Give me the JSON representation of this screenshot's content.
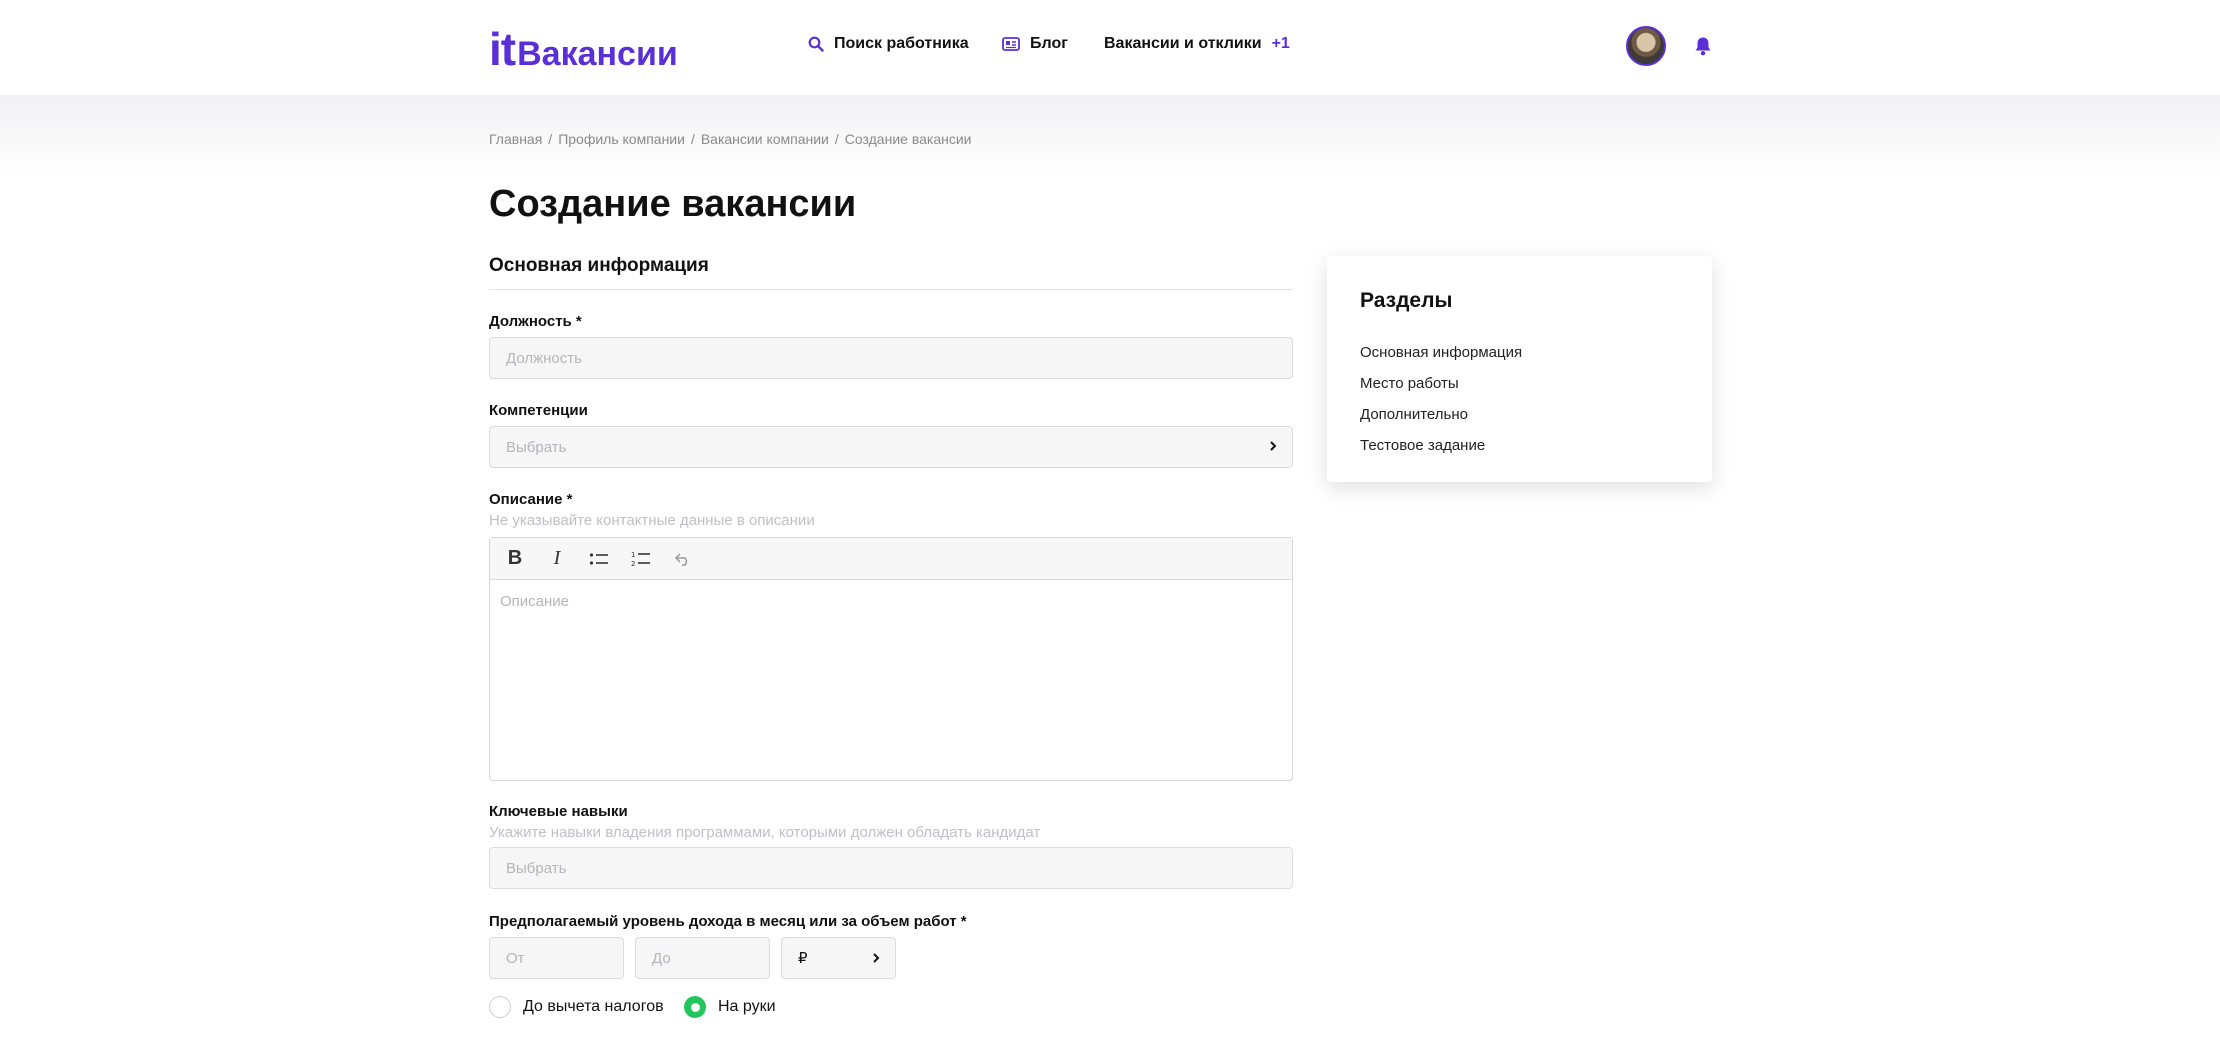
{
  "header": {
    "logo": {
      "it": "it",
      "rest": "Вакансии"
    },
    "nav": {
      "search": "Поиск работника",
      "blog": "Блог",
      "vacancies": "Вакансии и отклики",
      "vacancies_badge": "+1"
    }
  },
  "breadcrumb": [
    "Главная",
    "Профиль компании",
    "Вакансии компании",
    "Создание вакансии"
  ],
  "page_title": "Создание вакансии",
  "section_title": "Основная информация",
  "form": {
    "position": {
      "label": "Должность *",
      "placeholder": "Должность"
    },
    "competencies": {
      "label": "Компетенции",
      "placeholder": "Выбрать"
    },
    "description": {
      "label": "Описание *",
      "hint": "Не указывайте контактные данные в описании",
      "placeholder": "Описание"
    },
    "skills": {
      "label": "Ключевые навыки",
      "hint": "Укажите навыки владения программами, которыми должен обладать кандидат",
      "placeholder": "Выбрать"
    },
    "salary": {
      "label": "Предполагаемый уровень дохода в месяц или за объем работ *",
      "from_placeholder": "От",
      "to_placeholder": "До",
      "currency": "₽",
      "tax_options": [
        "До вычета налогов",
        "На руки"
      ],
      "tax_selected": "На руки"
    }
  },
  "sections_card": {
    "title": "Разделы",
    "items": [
      "Основная информация",
      "Место работы",
      "Дополнительно",
      "Тестовое задание"
    ]
  },
  "colors": {
    "accent": "#5a2fd8",
    "radio_on": "#22c55e"
  }
}
